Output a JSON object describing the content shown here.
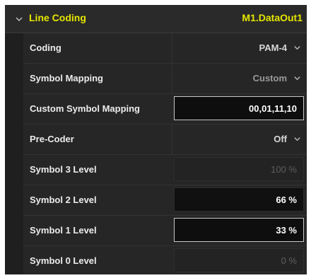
{
  "section": {
    "title": "Line Coding",
    "target": "M1.DataOut1"
  },
  "rows": [
    {
      "label": "Coding",
      "value": "PAM-4"
    },
    {
      "label": "Symbol Mapping",
      "value": "Custom"
    },
    {
      "label": "Custom Symbol Mapping",
      "value": "00,01,11,10"
    },
    {
      "label": "Pre-Coder",
      "value": "Off"
    },
    {
      "label": "Symbol 3 Level",
      "value": "100 %"
    },
    {
      "label": "Symbol 2 Level",
      "value": "66 %"
    },
    {
      "label": "Symbol 1 Level",
      "value": "33 %"
    },
    {
      "label": "Symbol 0 Level",
      "value": "0 %"
    }
  ],
  "colors": {
    "accent": "#e6e600",
    "panel": "#262626",
    "text": "#ececec"
  },
  "icons": {
    "collapse": "chevron-down-icon",
    "dropdown": "chevron-down-icon"
  }
}
